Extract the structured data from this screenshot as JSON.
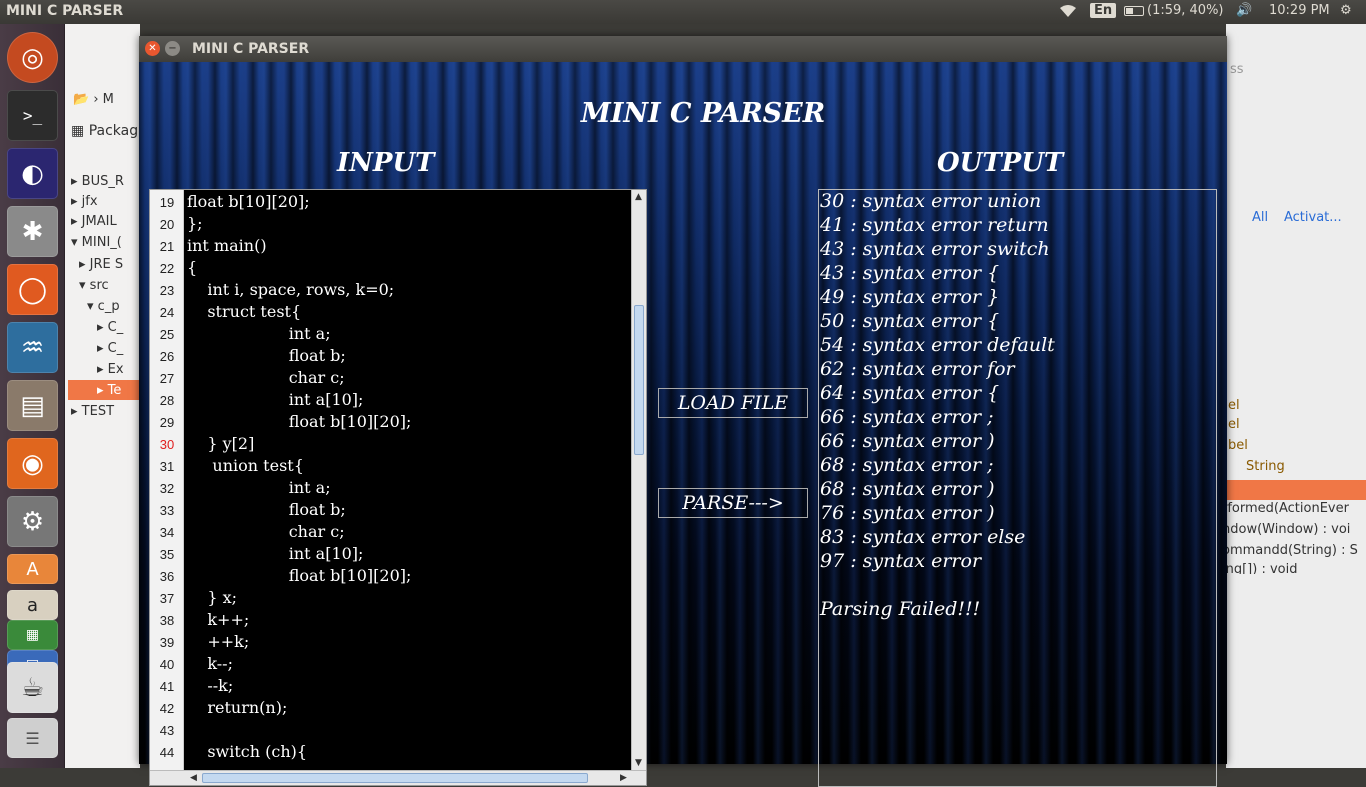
{
  "top_panel": {
    "app_title": "MINI C PARSER",
    "keyboard": "En",
    "battery": "(1:59, 40%)",
    "clock": "10:29 PM"
  },
  "launcher": {
    "items": [
      "ubuntu-dash-icon",
      "terminal-icon",
      "eclipse-icon",
      "web-icon",
      "ubuntu-one-icon",
      "mysql-icon",
      "files-icon",
      "firefox-icon",
      "system-settings-icon",
      "software-center-icon",
      "amazon-icon",
      "spreadsheet-icon",
      "writer-icon",
      "java-icon",
      "stack-icon"
    ]
  },
  "eclipse_left": {
    "breadcrumb": "M",
    "view_tab": "Packag",
    "tree": [
      {
        "label": "BUS_R"
      },
      {
        "label": "jfx"
      },
      {
        "label": "JMAIL"
      },
      {
        "label": "MINI_("
      },
      {
        "label": "JRE S"
      },
      {
        "label": "src"
      },
      {
        "label": "c_p"
      },
      {
        "label": "C_"
      },
      {
        "label": "C_"
      },
      {
        "label": "Ex"
      },
      {
        "label": "Te"
      },
      {
        "label": "TEST"
      }
    ]
  },
  "eclipse_right": {
    "breadcrumb_all": "All",
    "breadcrumb_activate": "Activat...",
    "search_hint": "ss",
    "outline": [
      "el",
      "el",
      "bel",
      "String",
      "rformed(ActionEver",
      "ndow(Window) : voi",
      "ommandd(String) : S",
      "ing[]) : void"
    ]
  },
  "window": {
    "title": "MINI C PARSER",
    "main_heading": "MINI C PARSER",
    "input_heading": "INPUT",
    "output_heading": "OUTPUT",
    "load_label": "LOAD FILE",
    "parse_label": "PARSE--->"
  },
  "editor": {
    "error_line": "30",
    "lines": [
      {
        "n": "19",
        "text": "float b[10][20];"
      },
      {
        "n": "20",
        "text": "};"
      },
      {
        "n": "21",
        "text": "int main()"
      },
      {
        "n": "22",
        "text": "{"
      },
      {
        "n": "23",
        "text": "    int i, space, rows, k=0;"
      },
      {
        "n": "24",
        "text": "    struct test{"
      },
      {
        "n": "25",
        "text": "                    int a;"
      },
      {
        "n": "26",
        "text": "                    float b;"
      },
      {
        "n": "27",
        "text": "                    char c;"
      },
      {
        "n": "28",
        "text": "                    int a[10];"
      },
      {
        "n": "29",
        "text": "                    float b[10][20];"
      },
      {
        "n": "30",
        "text": "    } y[2]"
      },
      {
        "n": "31",
        "text": "     union test{"
      },
      {
        "n": "32",
        "text": "                    int a;"
      },
      {
        "n": "33",
        "text": "                    float b;"
      },
      {
        "n": "34",
        "text": "                    char c;"
      },
      {
        "n": "35",
        "text": "                    int a[10];"
      },
      {
        "n": "36",
        "text": "                    float b[10][20];"
      },
      {
        "n": "37",
        "text": "    } x;"
      },
      {
        "n": "38",
        "text": "    k++;"
      },
      {
        "n": "39",
        "text": "    ++k;"
      },
      {
        "n": "40",
        "text": "    k--;"
      },
      {
        "n": "41",
        "text": "    --k;"
      },
      {
        "n": "42",
        "text": "    return(n);"
      },
      {
        "n": "43",
        "text": ""
      },
      {
        "n": "44",
        "text": "    switch (ch){"
      }
    ]
  },
  "output": {
    "lines": [
      "30 : syntax error union",
      "41 : syntax error return",
      "43 : syntax error switch",
      "43 : syntax error {",
      "49 : syntax error }",
      "50 : syntax error {",
      "54 : syntax error default",
      "62 : syntax error for",
      "64 : syntax error {",
      "66 : syntax error ;",
      "66 : syntax error )",
      "68 : syntax error ;",
      "68 : syntax error )",
      "76 : syntax error )",
      "83 : syntax error else",
      "97 : syntax error",
      "",
      "Parsing Failed!!!"
    ]
  }
}
